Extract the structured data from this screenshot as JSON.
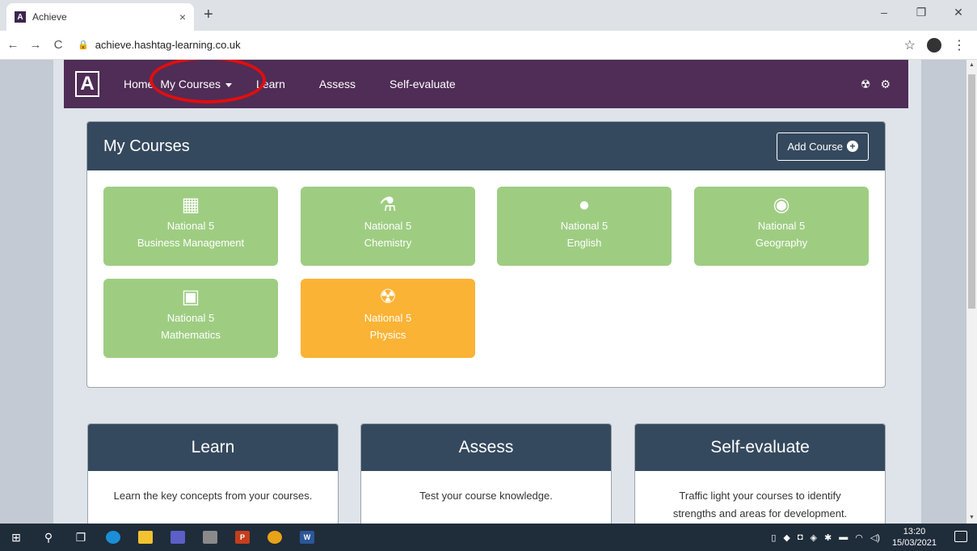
{
  "browser": {
    "tab_title": "Achieve",
    "tab_favicon": "A",
    "tab_close": "×",
    "new_tab": "+",
    "url": "achieve.hashtag-learning.co.uk",
    "window_controls": [
      "–",
      "❐",
      "✕"
    ],
    "nav": {
      "back": "←",
      "forward": "→",
      "reload": "C"
    }
  },
  "app": {
    "logo": "A",
    "nav": {
      "home": "Home",
      "my_courses": "My Courses",
      "learn": "Learn",
      "assess": "Assess",
      "self_evaluate": "Self-evaluate"
    },
    "icons": {
      "radiation": "☢",
      "settings": "⚙"
    }
  },
  "my_courses": {
    "title": "My Courses",
    "add_button": "Add Course",
    "courses": [
      {
        "level": "National 5",
        "name": "Business Management",
        "icon": "building-icon",
        "color": "#9ecd82"
      },
      {
        "level": "National 5",
        "name": "Chemistry",
        "icon": "flask-icon",
        "color": "#9ecd82"
      },
      {
        "level": "National 5",
        "name": "English",
        "icon": "reader-icon",
        "color": "#9ecd82"
      },
      {
        "level": "National 5",
        "name": "Geography",
        "icon": "globe-icon",
        "color": "#9ecd82"
      },
      {
        "level": "National 5",
        "name": "Mathematics",
        "icon": "calculator-icon",
        "color": "#9ecd82"
      },
      {
        "level": "National 5",
        "name": "Physics",
        "icon": "radiation-icon",
        "color": "#fbb335"
      }
    ]
  },
  "cards": [
    {
      "title": "Learn",
      "body": "Learn the key concepts from your courses."
    },
    {
      "title": "Assess",
      "body": "Test your course knowledge."
    },
    {
      "title": "Self-evaluate",
      "body": "Traffic light your courses to identify strengths and areas for development."
    }
  ],
  "taskbar": {
    "time": "13:20",
    "date": "15/03/2021"
  }
}
